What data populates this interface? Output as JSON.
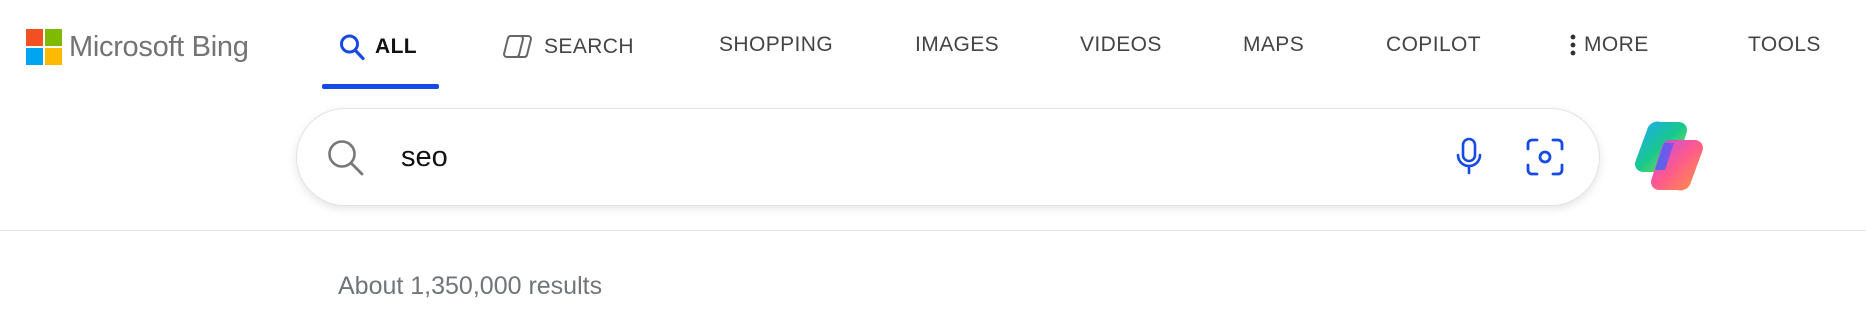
{
  "logo": {
    "text": "Microsoft Bing",
    "colors": [
      "#f25022",
      "#7fba00",
      "#00a4ef",
      "#ffb900"
    ]
  },
  "tabs": [
    {
      "label": "ALL",
      "icon": "search-icon",
      "active": true
    },
    {
      "label": "SEARCH",
      "icon": "copilot-search-icon"
    },
    {
      "label": "SHOPPING"
    },
    {
      "label": "IMAGES"
    },
    {
      "label": "VIDEOS"
    },
    {
      "label": "MAPS"
    },
    {
      "label": "COPILOT"
    },
    {
      "label": "MORE",
      "icon": "more-vertical-icon"
    },
    {
      "label": "TOOLS"
    }
  ],
  "search": {
    "query": "seo",
    "mic_icon": "microphone-icon",
    "visual_icon": "visual-search-icon"
  },
  "results": {
    "count_text": "About 1,350,000 results"
  },
  "colors": {
    "accent": "#174ae4",
    "text_muted": "#70757a"
  }
}
